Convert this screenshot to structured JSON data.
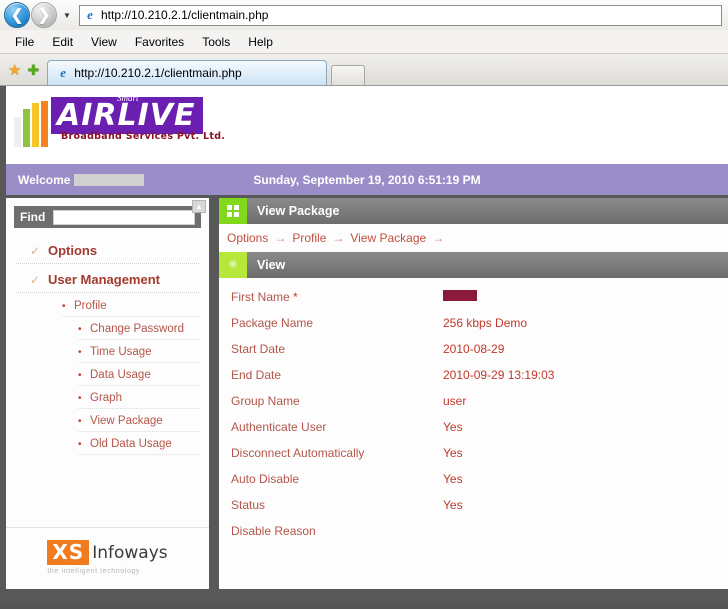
{
  "browser": {
    "back_icon": "back-arrow-icon",
    "forward_icon": "forward-arrow-icon",
    "history_caret": "▼",
    "address_value": "http://10.210.2.1/clientmain.php",
    "menu": [
      "File",
      "Edit",
      "View",
      "Favorites",
      "Tools",
      "Help"
    ],
    "favorites_star": "★",
    "add_favorite": "✚",
    "tab_title": "http://10.210.2.1/clientmain.php",
    "ie_glyph": "e"
  },
  "site": {
    "logo": {
      "script": "Smart",
      "word_a": "A",
      "word_rest": "IRLIVE",
      "tagline": "Broadband Services Pvt. Ltd."
    },
    "welcome": {
      "label": "Welcome",
      "date": "Sunday, September 19, 2010 6:51:19 PM"
    },
    "footer_logo": {
      "mark": "XS",
      "word": "Infoways",
      "tagline": "the intelligent technology"
    }
  },
  "sidebar": {
    "find_label": "Find",
    "find_value": "",
    "find_placeholder": "",
    "collapse_glyph": "▲",
    "top_items": [
      {
        "label": "Options",
        "check": "✓"
      },
      {
        "label": "User Management",
        "check": "✓"
      }
    ],
    "sub_items": [
      {
        "label": "Profile",
        "level": 1
      },
      {
        "label": "Change Password",
        "level": 2
      },
      {
        "label": "Time Usage",
        "level": 2
      },
      {
        "label": "Data Usage",
        "level": 2
      },
      {
        "label": "Graph",
        "level": 2
      },
      {
        "label": "View Package",
        "level": 2
      },
      {
        "label": "Old Data Usage",
        "level": 2
      }
    ],
    "bullet": "•"
  },
  "main": {
    "panel_title": "View Package",
    "panel_icon": "grid-icon",
    "breadcrumb": [
      "Options",
      "Profile",
      "View Package"
    ],
    "breadcrumb_sep": "→",
    "section_title": "View",
    "section_icon": "sun-icon",
    "rows": [
      {
        "label": "First Name",
        "required": true,
        "value": "",
        "redacted": true
      },
      {
        "label": "Package Name",
        "required": false,
        "value": "256 kbps Demo",
        "redacted": false
      },
      {
        "label": "Start Date",
        "required": false,
        "value": "2010-08-29",
        "redacted": false
      },
      {
        "label": "End Date",
        "required": false,
        "value": "2010-09-29 13:19:03",
        "redacted": false
      },
      {
        "label": "Group Name",
        "required": false,
        "value": "user",
        "redacted": false
      },
      {
        "label": "Authenticate User",
        "required": false,
        "value": "Yes",
        "redacted": false
      },
      {
        "label": "Disconnect Automatically",
        "required": false,
        "value": "Yes",
        "redacted": false
      },
      {
        "label": "Auto Disable",
        "required": false,
        "value": "Yes",
        "redacted": false
      },
      {
        "label": "Status",
        "required": false,
        "value": "Yes",
        "redacted": false
      },
      {
        "label": "Disable Reason",
        "required": false,
        "value": "",
        "redacted": false
      }
    ],
    "required_mark": "*"
  },
  "colors": {
    "accent_purple": "#6a1fb0",
    "welcome_band": "#9b8ec8",
    "link_red": "#c0392b",
    "icon_green": "#82d91c",
    "logo_orange": "#f07c1f"
  }
}
